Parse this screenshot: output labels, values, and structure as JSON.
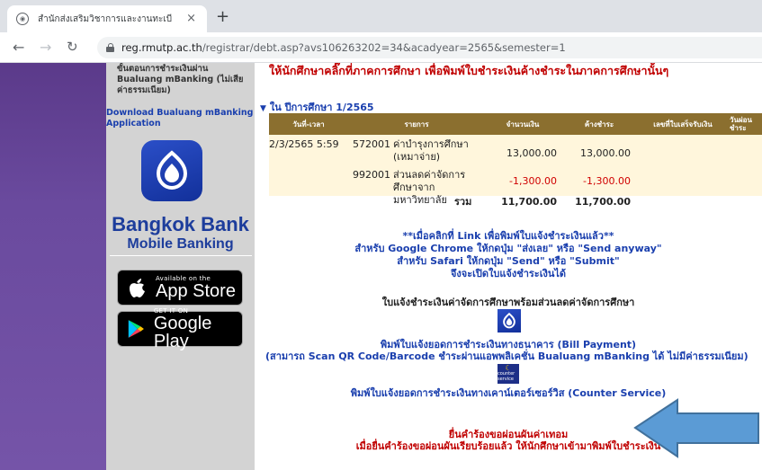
{
  "browser": {
    "tab_title": "สำนักส่งเสริมวิชาการและงานทะเบียน",
    "tab_close": "×",
    "new_tab": "+",
    "url_host": "reg.rmutp.ac.th",
    "url_path": "/registrar/debt.asp?avs106263202=34&acadyear=2565&semester=1"
  },
  "sidebar": {
    "instructions": "ขั้นตอนการชำระเงินผ่าน Bualuang mBanking (ไม่เสียค่าธรรมเนียม)",
    "download_link": "Download Bualuang mBanking Application",
    "bank_name": "Bangkok Bank",
    "bank_sub": "Mobile Banking",
    "appstore_small": "Available on the",
    "appstore_big": "App Store",
    "googleplay_small": "GET IT ON",
    "googleplay_big": "Google Play"
  },
  "main": {
    "header": "ให้นักศึกษาคลิ๊กที่ภาคการศึกษา เพื่อพิมพ์ใบชำระเงินค้างชำระในภาคการศึกษานั้นๆ",
    "year_heading": "ใน ปีการศึกษา 1/2565",
    "table": {
      "headers": [
        "วันที่-เวลา",
        "รายการ",
        "จำนวนเงิน",
        "ค้างชำระ",
        "เลขที่ใบเสร็จรับเงิน",
        "วันผ่อนชำระ"
      ],
      "rows": [
        {
          "datetime": "2/3/2565 5:59",
          "code": "572001",
          "desc": "ค่าบำรุงการศึกษา (เหมาจ่าย)",
          "amount": "13,000.00",
          "outstanding": "13,000.00"
        },
        {
          "datetime": "",
          "code": "992001",
          "desc": "ส่วนลดค่าจัดการศึกษาจากมหาวิทยาลัย",
          "amount": "-1,300.00",
          "outstanding": "-1,300.00"
        }
      ],
      "total_label": "รวม",
      "total_amount": "11,700.00",
      "total_outstanding": "11,700.00"
    },
    "notice": {
      "line1": "**เมื่อคลิกที่ Link เพื่อพิมพ์ใบแจ้งชำระเงินแล้ว**",
      "line2": "สำหรับ Google Chrome ให้กดปุ่ม \"ส่งเลย\" หรือ \"Send anyway\"",
      "line3": "สำหรับ Safari ให้กดปุ่ม \"Send\" หรือ \"Submit\"",
      "line4": "จึงจะเปิดใบแจ้งชำระเงินได้"
    },
    "invoice_title": "ใบแจ้งชำระเงินค่าจัดการศึกษาพร้อมส่วนลดค่าจัดการศึกษา",
    "bill_payment": "พิมพ์ใบแจ้งยอดการชำระเงินทางธนาคาร (Bill Payment)",
    "bill_payment_note": "(สามารถ Scan QR Code/Barcode ชำระผ่านแอพพลิเคชั่น Bualuang mBanking ได้ ไม่มีค่าธรรมเนียม)",
    "counter_service_icon_text": "counter service",
    "counter_service": "พิมพ์ใบแจ้งยอดการชำระเงินทางเคาน์เตอร์เซอร์วิส (Counter Service)",
    "installment_request": "ยื่นคำร้องขอผ่อนผันค่าเทอม",
    "installment_note": "เมื่อยื่นคำร้องขอผ่อนผันเรียบร้อยแล้ว ให้นักศึกษาเข้ามาพิมพ์ใบชำระเงิน"
  },
  "colors": {
    "header_red": "#c00000",
    "link_blue": "#1a3fae",
    "table_header": "#8b6f2f",
    "table_body": "#fff6dc",
    "arrow": "#5b9bd5"
  }
}
